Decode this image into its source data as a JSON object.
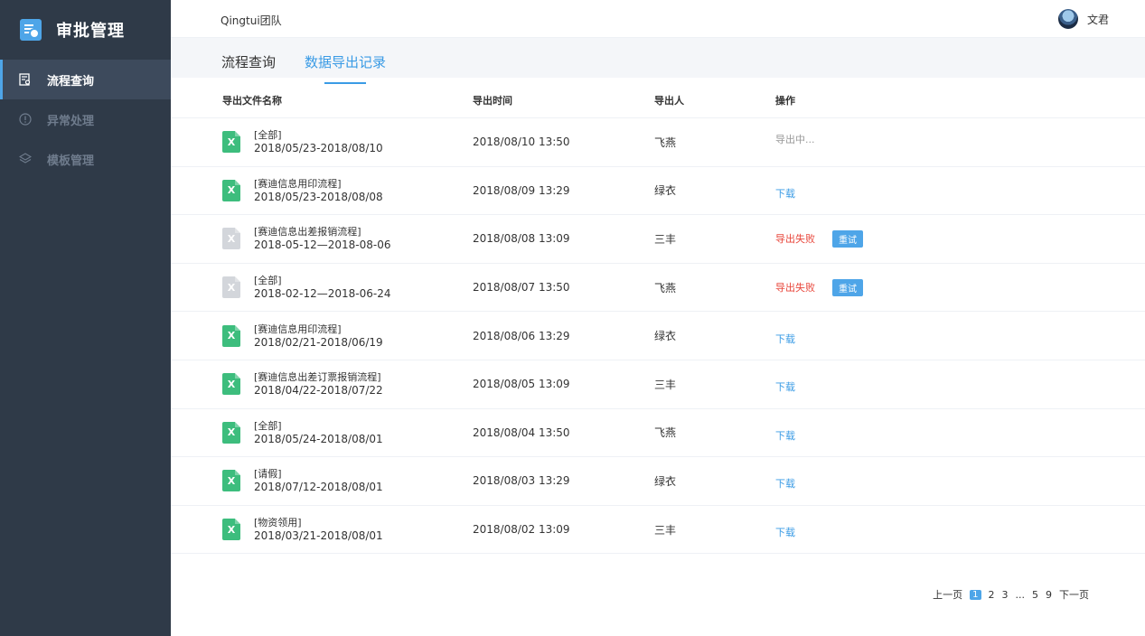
{
  "sidebar": {
    "title": "审批管理",
    "items": [
      {
        "label": "流程查询",
        "active": true
      },
      {
        "label": "异常处理",
        "active": false
      },
      {
        "label": "模板管理",
        "active": false
      }
    ]
  },
  "header": {
    "team": "Qingtui团队",
    "user": "文君"
  },
  "tabs": [
    {
      "label": "流程查询",
      "active": false
    },
    {
      "label": "数据导出记录",
      "active": true
    }
  ],
  "table": {
    "columns": [
      "导出文件名称",
      "导出时间",
      "导出人",
      "操作"
    ],
    "rows": [
      {
        "scope": "[全部]",
        "range": "2018/05/23-2018/08/10",
        "time": "2018/08/10 13:50",
        "user": "飞燕",
        "status": "pending",
        "op_label": "导出中..."
      },
      {
        "scope": "[赛迪信息用印流程]",
        "range": "2018/05/23-2018/08/08",
        "time": "2018/08/09 13:29",
        "user": "绿衣",
        "status": "done",
        "op_label": "下载"
      },
      {
        "scope": "[赛迪信息出差报销流程]",
        "range": "2018-05-12—2018-08-06",
        "time": "2018/08/08 13:09",
        "user": "三丰",
        "status": "failed",
        "op_label": "导出失败",
        "retry_label": "重试"
      },
      {
        "scope": "[全部]",
        "range": "2018-02-12—2018-06-24",
        "time": "2018/08/07 13:50",
        "user": "飞燕",
        "status": "failed",
        "op_label": "导出失败",
        "retry_label": "重试"
      },
      {
        "scope": "[赛迪信息用印流程]",
        "range": "2018/02/21-2018/06/19",
        "time": "2018/08/06 13:29",
        "user": "绿衣",
        "status": "done",
        "op_label": "下载"
      },
      {
        "scope": "[赛迪信息出差订票报销流程]",
        "range": "2018/04/22-2018/07/22",
        "time": "2018/08/05 13:09",
        "user": "三丰",
        "status": "done",
        "op_label": "下载"
      },
      {
        "scope": "[全部]",
        "range": "2018/05/24-2018/08/01",
        "time": "2018/08/04 13:50",
        "user": "飞燕",
        "status": "done",
        "op_label": "下载"
      },
      {
        "scope": "[请假]",
        "range": "2018/07/12-2018/08/01",
        "time": "2018/08/03 13:29",
        "user": "绿衣",
        "status": "done",
        "op_label": "下载"
      },
      {
        "scope": "[物资领用]",
        "range": "2018/03/21-2018/08/01",
        "time": "2018/08/02 13:09",
        "user": "三丰",
        "status": "done",
        "op_label": "下载"
      }
    ]
  },
  "file_icon_letter": "X",
  "pagination": {
    "prev": "上一页",
    "current": "1",
    "pages": [
      "2",
      "3",
      "...",
      "5",
      "9"
    ],
    "next": "下一页"
  },
  "colors": {
    "sidebar_bg": "#2f3a48",
    "accent": "#3a9be5",
    "success_icon": "#3dbd7d",
    "error": "#e8473c"
  }
}
